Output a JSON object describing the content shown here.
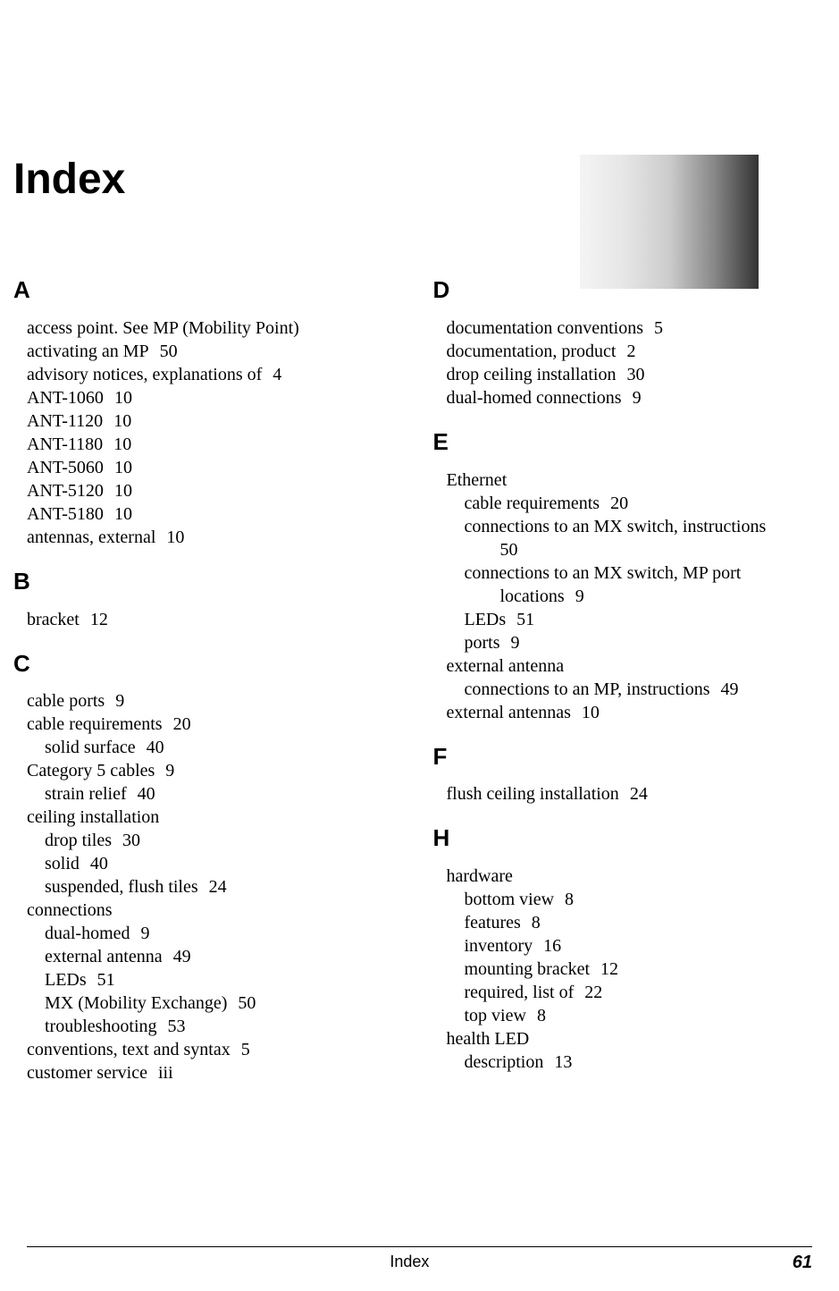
{
  "title": "Index",
  "footer": {
    "center": "Index",
    "page": "61"
  },
  "left": {
    "A": [
      {
        "t": "access point. See MP (Mobility Point)"
      },
      {
        "t": "activating an MP",
        "p": "50"
      },
      {
        "t": "advisory notices, explanations of",
        "p": "4"
      },
      {
        "t": "ANT-1060",
        "p": "10"
      },
      {
        "t": "ANT-1120",
        "p": "10"
      },
      {
        "t": "ANT-1180",
        "p": "10"
      },
      {
        "t": "ANT-5060",
        "p": "10"
      },
      {
        "t": "ANT-5120",
        "p": "10"
      },
      {
        "t": "ANT-5180",
        "p": "10"
      },
      {
        "t": "antennas, external",
        "p": "10"
      }
    ],
    "B": [
      {
        "t": "bracket",
        "p": "12"
      }
    ],
    "C": [
      {
        "t": "cable ports",
        "p": "9"
      },
      {
        "t": "cable requirements",
        "p": "20"
      },
      {
        "t": "solid surface",
        "p": "40",
        "lvl": 1
      },
      {
        "t": "Category 5 cables",
        "p": "9"
      },
      {
        "t": "strain relief",
        "p": "40",
        "lvl": 1
      },
      {
        "t": "ceiling installation"
      },
      {
        "t": "drop tiles",
        "p": "30",
        "lvl": 1
      },
      {
        "t": "solid",
        "p": "40",
        "lvl": 1
      },
      {
        "t": "suspended, flush tiles",
        "p": "24",
        "lvl": 1
      },
      {
        "t": "connections"
      },
      {
        "t": "dual-homed",
        "p": "9",
        "lvl": 1
      },
      {
        "t": "external antenna",
        "p": "49",
        "lvl": 1
      },
      {
        "t": "LEDs",
        "p": "51",
        "lvl": 1
      },
      {
        "t": "MX (Mobility Exchange)",
        "p": "50",
        "lvl": 1
      },
      {
        "t": "troubleshooting",
        "p": "53",
        "lvl": 1
      },
      {
        "t": "conventions, text and syntax",
        "p": "5"
      },
      {
        "t": "customer service",
        "p": "iii"
      }
    ]
  },
  "right": {
    "D": [
      {
        "t": "documentation conventions",
        "p": "5"
      },
      {
        "t": "documentation, product",
        "p": "2"
      },
      {
        "t": "drop ceiling installation",
        "p": "30"
      },
      {
        "t": "dual-homed connections",
        "p": "9"
      }
    ],
    "E": [
      {
        "t": "Ethernet"
      },
      {
        "t": "cable requirements",
        "p": "20",
        "lvl": 1
      },
      {
        "t": "connections to an MX switch, instructions",
        "lvl": 1
      },
      {
        "t": "50",
        "lvl": 2,
        "raw": true
      },
      {
        "t": "connections to an MX switch, MP port",
        "lvl": 1
      },
      {
        "t": "locations",
        "p": "9",
        "lvl": 2
      },
      {
        "t": "LEDs",
        "p": "51",
        "lvl": 1
      },
      {
        "t": "ports",
        "p": "9",
        "lvl": 1
      },
      {
        "t": "external antenna"
      },
      {
        "t": "connections to an MP, instructions",
        "p": "49",
        "lvl": 1
      },
      {
        "t": "external antennas",
        "p": "10"
      }
    ],
    "F": [
      {
        "t": "flush ceiling installation",
        "p": "24"
      }
    ],
    "H": [
      {
        "t": "hardware"
      },
      {
        "t": "bottom view",
        "p": "8",
        "lvl": 1
      },
      {
        "t": "features",
        "p": "8",
        "lvl": 1
      },
      {
        "t": "inventory",
        "p": "16",
        "lvl": 1
      },
      {
        "t": "mounting bracket",
        "p": "12",
        "lvl": 1
      },
      {
        "t": "required, list of",
        "p": "22",
        "lvl": 1
      },
      {
        "t": "top view",
        "p": "8",
        "lvl": 1
      },
      {
        "t": "health LED"
      },
      {
        "t": "description",
        "p": "13",
        "lvl": 1
      }
    ]
  }
}
